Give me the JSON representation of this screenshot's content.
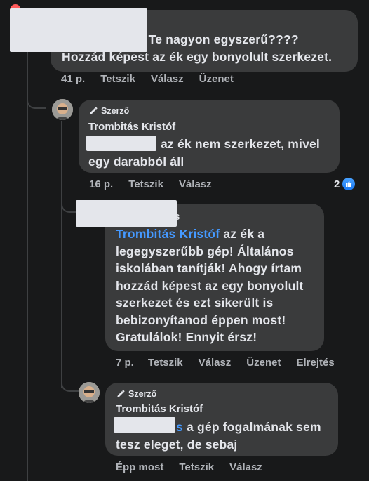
{
  "comments": [
    {
      "text_lines": [
        "Milyen ellenár Te nagyon egyszerű????",
        "Hozzád képest az ék egy bonyolult szerkezet."
      ],
      "actions": [
        "41 p.",
        "Tetszik",
        "Válasz",
        "Üzenet"
      ]
    },
    {
      "author_tag": "Szerző",
      "author": "Trombitás Kristóf",
      "text_lines": [
        "az ék nem szerkezet, mivel",
        "egy darabból áll"
      ],
      "actions": [
        "16 p.",
        "Tetszik",
        "Válasz"
      ],
      "reaction_count": "2"
    },
    {
      "name_tail": "s",
      "mention": "Trombitás Kristóf",
      "text_lines": [
        " az ék a",
        "legegyszerűbb gép!  Általános",
        "iskolában tanítják! Ahogy írtam",
        "hozzád képest az egy bonyolult",
        "szerkezet és ezt sikerült is",
        "bebizonyítanod éppen most!",
        "Gratulálok! Ennyit érsz!"
      ],
      "actions": [
        "7 p.",
        "Tetszik",
        "Válasz",
        "Üzenet",
        "Elrejtés"
      ]
    },
    {
      "author_tag": "Szerző",
      "author": "Trombitás Kristóf",
      "mention_tail": "s",
      "text_lines": [
        " a gép fogalmának sem",
        "tesz eleget, de sebaj"
      ],
      "actions": [
        "Épp most",
        "Tetszik",
        "Válasz"
      ]
    }
  ],
  "colors": {
    "bubble": "#3a3b3c",
    "background": "#18191a",
    "mention": "#4599ff",
    "like": "#1877f2"
  },
  "icons": [
    "pen-icon",
    "like-icon"
  ]
}
